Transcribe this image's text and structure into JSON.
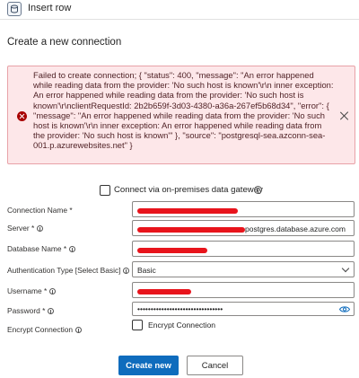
{
  "header": {
    "title": "Insert row",
    "icon": "database-icon"
  },
  "section_title": "Create a new connection",
  "error": {
    "message": "Failed to create connection; { \"status\": 400, \"message\": \"An error happened while reading data from the provider: 'No such host is known'\\r\\n inner exception: An error happened while reading data from the provider: 'No such host is known'\\r\\nclientRequestId: 2b2b659f-3d03-4380-a36a-267ef5b68d34\", \"error\": { \"message\": \"An error happened while reading data from the provider: 'No such host is known'\\r\\n inner exception: An error happened while reading data from the provider: 'No such host is known'\" }, \"source\": \"postgresql-sea.azconn-sea-001.p.azurewebsites.net\" }",
    "color": "#a80000"
  },
  "gateway": {
    "label": "Connect via on-premises data gateway",
    "checked": false
  },
  "fields": {
    "connection_name": {
      "label": "Connection Name *"
    },
    "server": {
      "label": "Server *",
      "value_suffix": "postgres.database.azure.com"
    },
    "database_name": {
      "label": "Database Name *"
    },
    "auth_type": {
      "label": "Authentication Type [Select Basic]",
      "value": "Basic"
    },
    "username": {
      "label": "Username *"
    },
    "password": {
      "label": "Password *",
      "value": "••••••••••••••••••••••••••••••••"
    },
    "encrypt": {
      "label": "Encrypt Connection",
      "checkbox_label": "Encrypt Connection",
      "checked": false
    }
  },
  "buttons": {
    "create": "Create new",
    "cancel": "Cancel"
  },
  "colors": {
    "primary": "#0f6cbd",
    "error_bg": "#fde7e9",
    "redaction": "#e8141c"
  }
}
